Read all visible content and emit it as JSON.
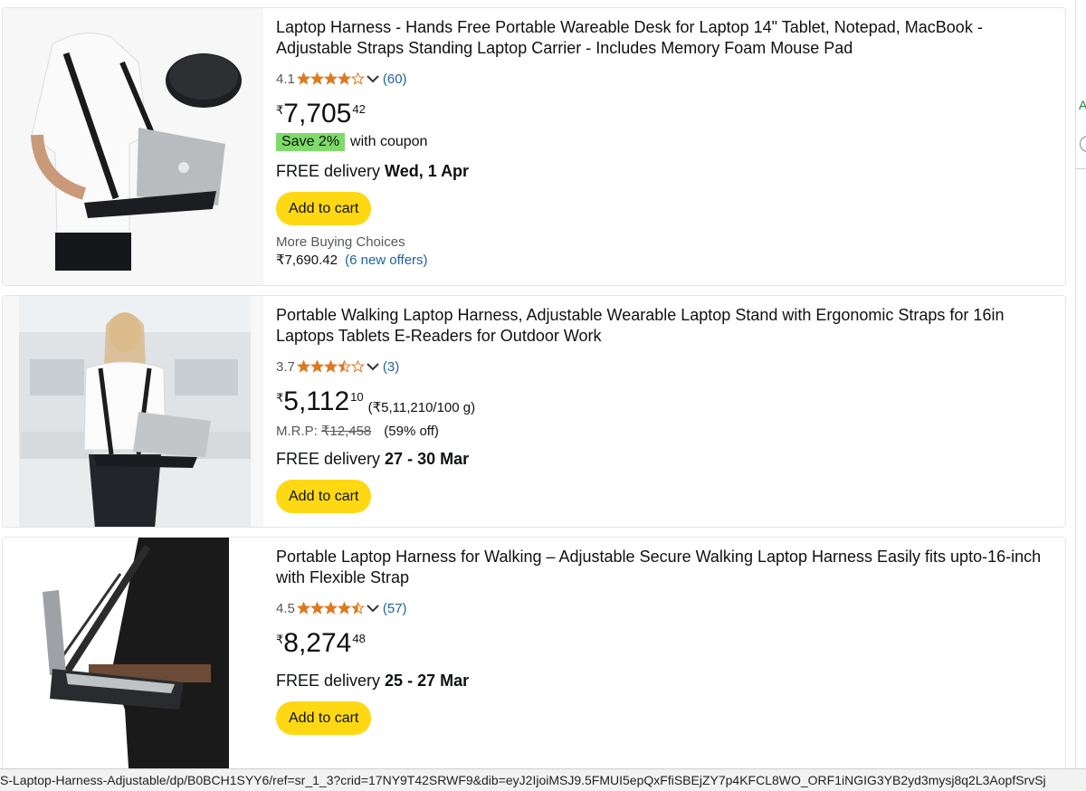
{
  "products": [
    {
      "title": "Laptop Harness - Hands Free Portable Wareable Desk for Laptop 14\" Tablet, Notepad, MacBook - Adjustable Straps Standing Laptop Carrier - Includes Memory Foam Mouse Pad",
      "rating": "4.1",
      "stars_value": 4.1,
      "review_count": "(60)",
      "currency": "₹",
      "price_whole": "7,705",
      "price_fraction": "42",
      "coupon_badge": "Save 2%",
      "coupon_text": "with coupon",
      "delivery_prefix": "FREE delivery",
      "delivery_date": "Wed, 1 Apr",
      "cart_label": "Add to cart",
      "more_label": "More Buying Choices",
      "more_price": "₹7,690.42",
      "more_offers": "(6 new offers)",
      "image_icon": "laptop-harness-mousepad-image"
    },
    {
      "title": "Portable Walking Laptop Harness, Adjustable Wearable Laptop Stand with Ergonomic Straps for 16in Laptops Tablets E-Readers for Outdoor Work",
      "rating": "3.7",
      "stars_value": 3.7,
      "review_count": "(3)",
      "currency": "₹",
      "price_whole": "5,112",
      "price_fraction": "10",
      "unit_price": "(₹5,11,210/100 g)",
      "mrp_label": "M.R.P:",
      "mrp_value": "₹12,458",
      "discount": "(59% off)",
      "delivery_prefix": "FREE delivery",
      "delivery_date": "27 - 30 Mar",
      "cart_label": "Add to cart",
      "image_icon": "woman-office-harness-image"
    },
    {
      "title": "Portable Laptop Harness for Walking – Adjustable Secure Walking Laptop Harness Easily fits upto-16-inch with Flexible Strap",
      "rating": "4.5",
      "stars_value": 4.5,
      "review_count": "(57)",
      "currency": "₹",
      "price_whole": "8,274",
      "price_fraction": "48",
      "delivery_prefix": "FREE delivery",
      "delivery_date": "25 - 27 Mar",
      "cart_label": "Add to cart",
      "image_icon": "man-walking-harness-image"
    }
  ],
  "status_url": "S-Laptop-Harness-Adjustable/dp/B0BCH1SYY6/ref=sr_1_3?crid=17NY9T42SRWF9&dib=eyJ2IjoiMSJ9.5FMUI5epQxFfiSBEjZY7p4KFCL8WO_ORF1iNGIG3YB2yd3mysj8q2L3AopfSrvSj",
  "sidebar_edge_letter": "A",
  "colors": {
    "star": "#de7921",
    "link": "#2162a1",
    "cart_button": "#ffd814",
    "coupon": "#7fda69"
  }
}
